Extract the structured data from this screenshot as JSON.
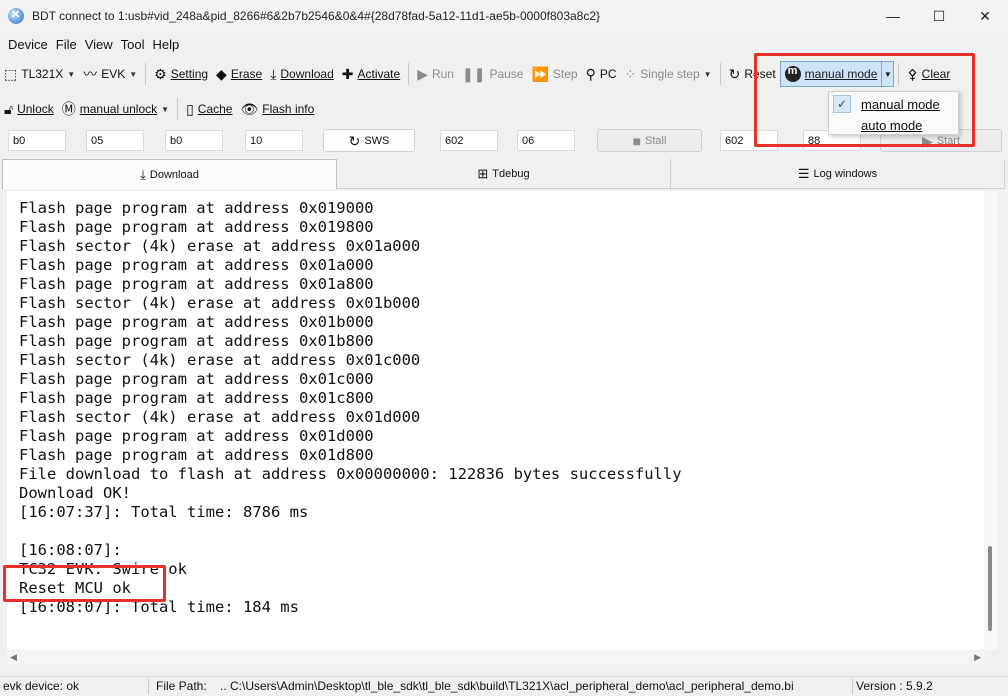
{
  "window": {
    "title": "BDT connect to 1:usb#vid_248a&pid_8266#6&2b7b2546&0&4#{28d78fad-5a12-11d1-ae5b-0000f803a8c2}",
    "minimize": "—",
    "maximize": "☐",
    "close": "✕"
  },
  "menu": [
    "Device",
    "File",
    "View",
    "Tool",
    "Help"
  ],
  "toolbar1": {
    "chip": "TL321X",
    "board": "EVK",
    "setting": "Setting",
    "erase": "Erase",
    "download": "Download",
    "activate": "Activate",
    "run": "Run",
    "pause": "Pause",
    "step": "Step",
    "pc": "PC",
    "single_step": "Single step",
    "reset": "Reset",
    "mode": "manual mode",
    "clear": "Clear"
  },
  "toolbar2": {
    "unlock": "Unlock",
    "manual_unlock": "manual unlock",
    "cache": "Cache",
    "flash_info": "Flash info"
  },
  "fields": {
    "f1": "b0",
    "f2": "05",
    "f3": "b0",
    "f4": "10",
    "sws": "SWS",
    "f5": "602",
    "f6": "06",
    "stall": "Stall",
    "f7": "602",
    "f8": "88",
    "start": "Start"
  },
  "tabs": {
    "download": "Download",
    "tdebug": "Tdebug",
    "log": "Log windows"
  },
  "mode_menu": {
    "manual": "manual mode",
    "auto": "auto mode",
    "checked": "manual"
  },
  "log": [
    "Flash page program at address 0x019000",
    "Flash page program at address 0x019800",
    "Flash sector (4k) erase at address 0x01a000",
    "Flash page program at address 0x01a000",
    "Flash page program at address 0x01a800",
    "Flash sector (4k) erase at address 0x01b000",
    "Flash page program at address 0x01b000",
    "Flash page program at address 0x01b800",
    "Flash sector (4k) erase at address 0x01c000",
    "Flash page program at address 0x01c000",
    "Flash page program at address 0x01c800",
    "Flash sector (4k) erase at address 0x01d000",
    "Flash page program at address 0x01d000",
    "Flash page program at address 0x01d800",
    "File download to flash at address 0x00000000: 122836 bytes successfully",
    "Download OK!",
    "[16:07:37]: Total time: 8786 ms",
    "",
    "[16:08:07]:",
    "TC32 EVK: Swire ok",
    "Reset MCU ok",
    "[16:08:07]: Total time: 184 ms"
  ],
  "status": {
    "device": "evk device: ok",
    "file_path_label": "File Path:",
    "file_path": "..  C:\\Users\\Admin\\Desktop\\tl_ble_sdk\\tl_ble_sdk\\build\\TL321X\\acl_peripheral_demo\\acl_peripheral_demo.bi",
    "version": "Version : 5.9.2"
  },
  "colors": {
    "highlight": "#e8302b",
    "selected_mode": "#cfe3f7"
  }
}
